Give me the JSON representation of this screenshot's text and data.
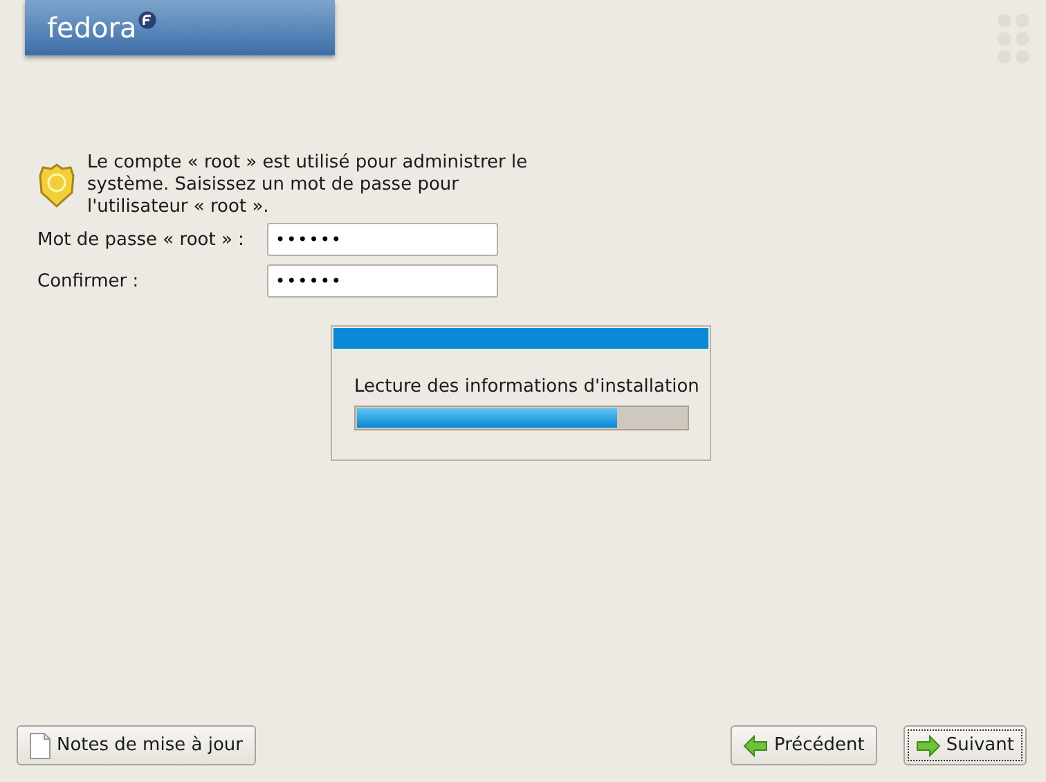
{
  "header": {
    "logo": "fedora"
  },
  "root_password": {
    "description": "Le compte « root » est utilisé pour administrer le système. Saisissez un mot de passe pour l'utilisateur « root ».",
    "fields": [
      {
        "label": "Mot de passe « root » :",
        "value": "••••••"
      },
      {
        "label": "Confirmer :",
        "value": "••••••"
      }
    ]
  },
  "progress_dialog": {
    "message": "Lecture des informations d'installation",
    "level": 0.79
  },
  "buttons": [
    {
      "label": "Notes de mise à jour",
      "kind": "notes",
      "focused": false
    },
    {
      "label": "Précédent",
      "kind": "back",
      "focused": false
    },
    {
      "label": "Suivant",
      "kind": "next",
      "focused": true
    }
  ]
}
